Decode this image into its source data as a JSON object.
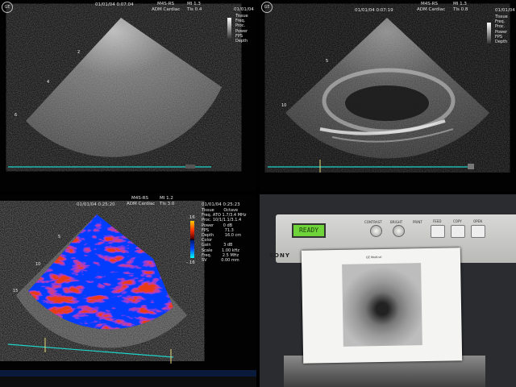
{
  "panels": {
    "p1": {
      "probe": "M4S-RS",
      "date_time": "01/01/04 0:07:04",
      "app": "ADM Cardiac",
      "mi": "MI 1.3",
      "tis": "TIs 0.4",
      "clock_right": "01/01/04",
      "params": [
        "Tissue",
        "Freq.",
        "Proc.",
        "Power",
        "FPS",
        "Depth"
      ],
      "depth_marks": [
        "2",
        "4",
        "6"
      ]
    },
    "p2": {
      "probe": "M4S-RS",
      "date_time": "01/01/04 0:07:19",
      "app": "ADM Cardiac",
      "mi": "MI 1.3",
      "tis": "TIs 0.8",
      "clock_right": "01/01/04",
      "params": [
        "Tissue",
        "Freq.",
        "Proc.",
        "Power",
        "FPS",
        "Depth"
      ],
      "depth_marks": [
        "5",
        "10"
      ]
    },
    "p3": {
      "probe": "M4S-RS",
      "date_time": "01/01/04 0:25:20",
      "app": "ADM Cardiac",
      "mi": "MI 1.2",
      "tis": "TIs 3.0",
      "clock_right": "01/01/04 0:25:23",
      "scale_top": ".16",
      "scale_bottom": "-.16",
      "params": [
        {
          "label": "Tissue",
          "value": "Octave"
        },
        {
          "label": "Freq. ATO",
          "value": "1.7/3.4 MHz"
        },
        {
          "label": "Proc.",
          "value": "10/1/1.1/3.1.4"
        },
        {
          "label": "Power",
          "value": "0 dB"
        },
        {
          "label": "FPS",
          "value": "71.3"
        },
        {
          "label": "Depth",
          "value": "16.0 cm"
        },
        {
          "label": "Color",
          "value": ""
        },
        {
          "label": "Gain",
          "value": "3 dB"
        },
        {
          "label": "Scale",
          "value": "1.00 kHz"
        },
        {
          "label": "Freq.",
          "value": "2.5 MHz"
        },
        {
          "label": "SV",
          "value": "0.00 mm"
        }
      ],
      "depth_marks": [
        "5",
        "10",
        "15"
      ]
    },
    "p4": {
      "lcd": "READY",
      "brand": "SONY",
      "buttons": [
        "FEED",
        "COPY",
        "OPEN"
      ],
      "labels": [
        "CONTRAST",
        "BRIGHT",
        "PRINT"
      ],
      "print_header": "GE Medical"
    }
  },
  "colors": {
    "timeline": "#1fd3c8",
    "doppler_red": "#e0191c",
    "doppler_blue": "#1730e6"
  }
}
